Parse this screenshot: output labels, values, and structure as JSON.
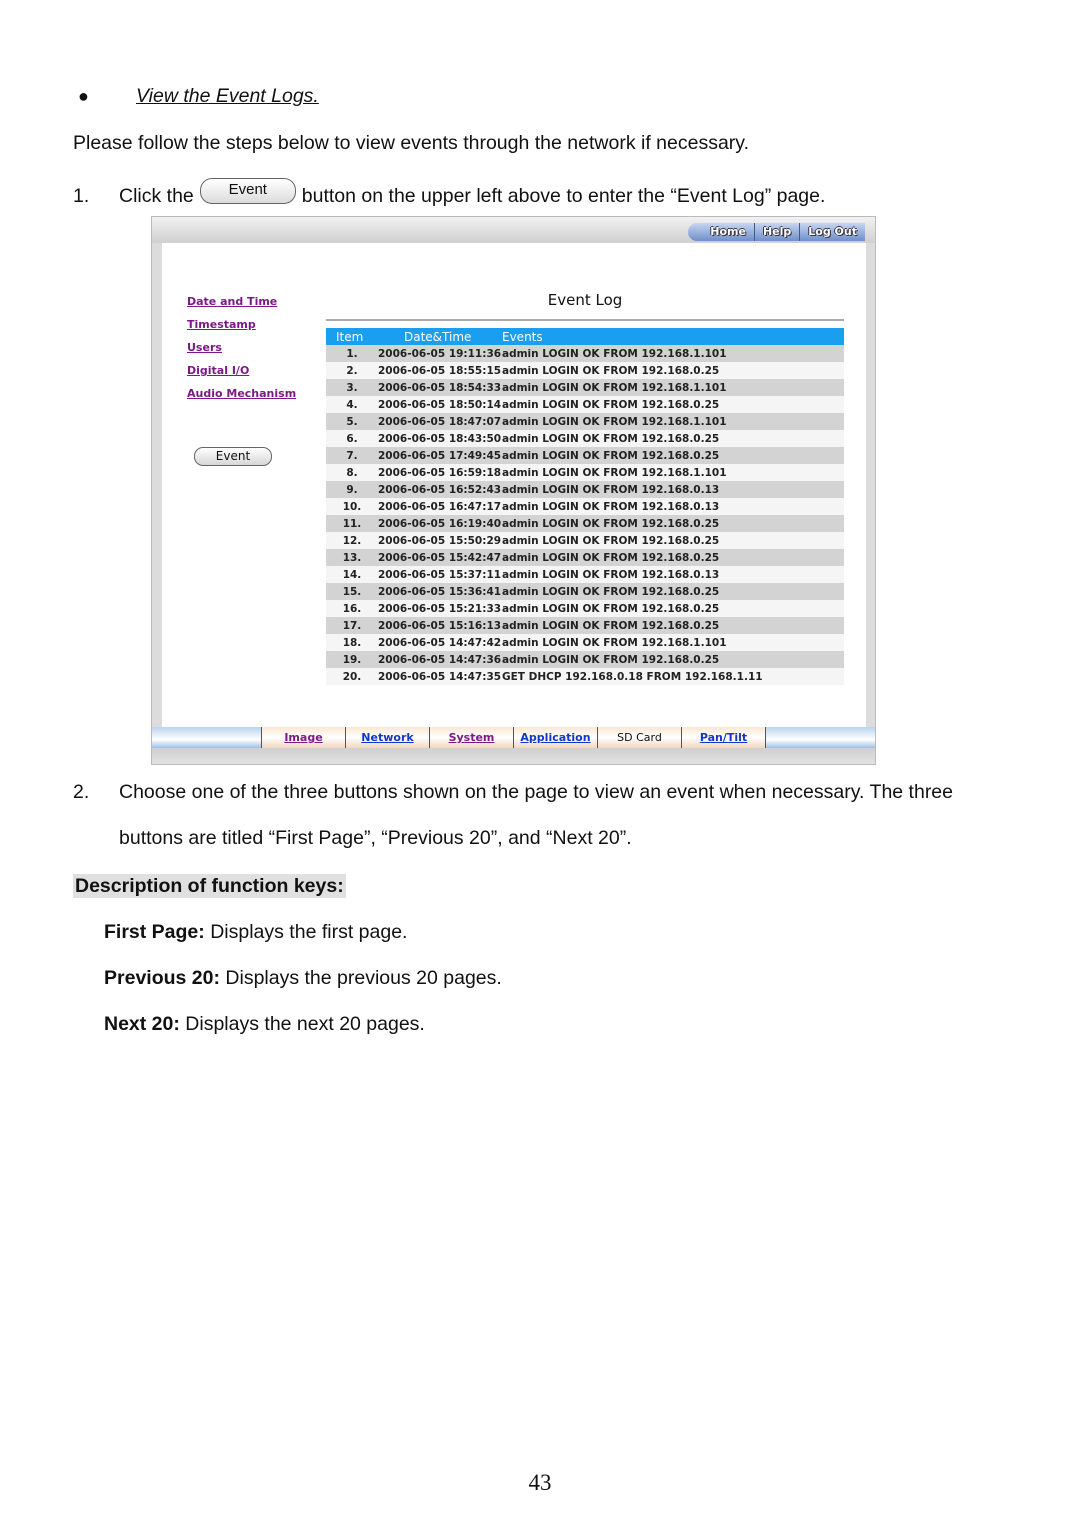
{
  "document": {
    "section_title": "View the Event Logs.",
    "intro": "Please follow the steps below to view events through the network if necessary.",
    "steps": [
      {
        "number": "1.",
        "before": "Click the",
        "button_label": "Event",
        "after": "button on the upper left above to enter the “Event Log” page."
      },
      {
        "number": "2.",
        "line1": "Choose one of the three buttons shown on the page to view an event when necessary. The three",
        "line2": "buttons are titled “First Page”, “Previous 20”, and “Next 20”."
      }
    ],
    "description_heading": "Description of function keys:",
    "function_keys": [
      {
        "key": "First Page:",
        "desc": " Displays the first page."
      },
      {
        "key": "Previous 20:",
        "desc": " Displays the previous 20 pages."
      },
      {
        "key": "Next 20:",
        "desc": " Displays the next 20 pages."
      }
    ],
    "page_number": "43"
  },
  "screenshot": {
    "top_nav": [
      "Home",
      "Help",
      "Log Out"
    ],
    "side_links": [
      "Date and Time",
      "Timestamp",
      "Users",
      "Digital I/O",
      "Audio Mechanism"
    ],
    "event_button": "Event",
    "title": "Event Log",
    "columns": [
      "Item",
      "Date&Time",
      "Events"
    ],
    "rows": [
      [
        "1.",
        "2006-06-05 19:11:36",
        "admin LOGIN OK FROM 192.168.1.101"
      ],
      [
        "2.",
        "2006-06-05 18:55:15",
        "admin LOGIN OK FROM 192.168.0.25"
      ],
      [
        "3.",
        "2006-06-05 18:54:33",
        "admin LOGIN OK FROM 192.168.1.101"
      ],
      [
        "4.",
        "2006-06-05 18:50:14",
        "admin LOGIN OK FROM 192.168.0.25"
      ],
      [
        "5.",
        "2006-06-05 18:47:07",
        "admin LOGIN OK FROM 192.168.1.101"
      ],
      [
        "6.",
        "2006-06-05 18:43:50",
        "admin LOGIN OK FROM 192.168.0.25"
      ],
      [
        "7.",
        "2006-06-05 17:49:45",
        "admin LOGIN OK FROM 192.168.0.25"
      ],
      [
        "8.",
        "2006-06-05 16:59:18",
        "admin LOGIN OK FROM 192.168.1.101"
      ],
      [
        "9.",
        "2006-06-05 16:52:43",
        "admin LOGIN OK FROM 192.168.0.13"
      ],
      [
        "10.",
        "2006-06-05 16:47:17",
        "admin LOGIN OK FROM 192.168.0.13"
      ],
      [
        "11.",
        "2006-06-05 16:19:40",
        "admin LOGIN OK FROM 192.168.0.25"
      ],
      [
        "12.",
        "2006-06-05 15:50:29",
        "admin LOGIN OK FROM 192.168.0.25"
      ],
      [
        "13.",
        "2006-06-05 15:42:47",
        "admin LOGIN OK FROM 192.168.0.25"
      ],
      [
        "14.",
        "2006-06-05 15:37:11",
        "admin LOGIN OK FROM 192.168.0.13"
      ],
      [
        "15.",
        "2006-06-05 15:36:41",
        "admin LOGIN OK FROM 192.168.0.25"
      ],
      [
        "16.",
        "2006-06-05 15:21:33",
        "admin LOGIN OK FROM 192.168.0.25"
      ],
      [
        "17.",
        "2006-06-05 15:16:13",
        "admin LOGIN OK FROM 192.168.0.25"
      ],
      [
        "18.",
        "2006-06-05 14:47:42",
        "admin LOGIN OK FROM 192.168.1.101"
      ],
      [
        "19.",
        "2006-06-05 14:47:36",
        "admin LOGIN OK FROM 192.168.0.25"
      ],
      [
        "20.",
        "2006-06-05 14:47:35",
        "GET DHCP 192.168.0.18 FROM 192.168.1.11"
      ]
    ],
    "pager": [
      "First Page",
      "Previous 20",
      "Next 20"
    ],
    "bottom_tabs": [
      {
        "label": "Image",
        "style": "visited"
      },
      {
        "label": "Network",
        "style": "link"
      },
      {
        "label": "System",
        "style": "visited"
      },
      {
        "label": "Application",
        "style": "link"
      },
      {
        "label": "SD Card",
        "style": "plain"
      },
      {
        "label": "Pan/Tilt",
        "style": "link"
      }
    ],
    "colors": {
      "header_blue": "#1a9ff0",
      "visited_link": "#7b1a86",
      "link": "#1238c8"
    }
  }
}
